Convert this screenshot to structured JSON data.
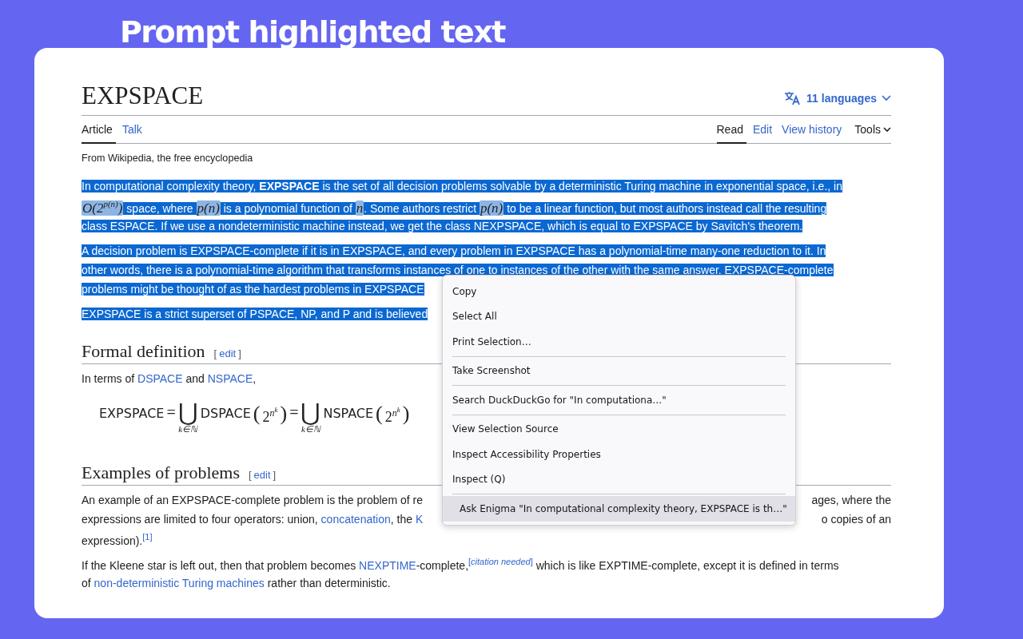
{
  "banner": {
    "title": "Prompt highlighted text"
  },
  "page": {
    "title": "EXPSPACE",
    "languages": "11 languages",
    "tabs_left": [
      {
        "label": "Article",
        "selected": true
      },
      {
        "label": "Talk",
        "selected": false
      }
    ],
    "tabs_right": [
      {
        "label": "Read",
        "selected": true
      },
      {
        "label": "Edit",
        "selected": false
      },
      {
        "label": "View history",
        "selected": false
      }
    ],
    "tools": "Tools",
    "tagline": "From Wikipedia, the free encyclopedia",
    "lead": [
      {
        "selected": true,
        "lines": [
          {
            "left": [
              {
                "kind": "text",
                "text": "In computational complexity theory, **EXPSPACE** is the set of all decision problems solvable by a deterministic Turing machine in exponential space, i.e., in"
              }
            ]
          },
          {
            "left": [
              {
                "kind": "math",
                "text": "O(2$^{p(n)}$)"
              },
              {
                "kind": "text",
                "text": " space, where "
              },
              {
                "kind": "math",
                "text": "p(n)"
              },
              {
                "kind": "text",
                "text": " is a polynomial function of "
              },
              {
                "kind": "math",
                "text": "n"
              },
              {
                "kind": "text",
                "text": ". Some authors restrict "
              },
              {
                "kind": "math",
                "text": "p(n)"
              },
              {
                "kind": "text",
                "text": " to be a linear function, but most authors instead call the resulting"
              }
            ]
          },
          {
            "left": [
              {
                "kind": "text",
                "text": "class ESPACE. If we use a nondeterministic machine instead, we get the class NEXPSPACE, which is equal to EXPSPACE by Savitch's theorem."
              }
            ]
          }
        ]
      },
      {
        "selected": true,
        "lines": [
          {
            "left": [
              {
                "kind": "text",
                "text": "A decision problem is EXPSPACE-complete if it is in EXPSPACE, and every problem in EXPSPACE has a polynomial-time many-one reduction to it. In"
              }
            ]
          },
          {
            "left": [
              {
                "kind": "text",
                "text": "other words, there is a polynomial-time algorithm that transforms instances of one to instances of the other with the same answer. EXPSPACE-complete"
              }
            ]
          },
          {
            "left": [
              {
                "kind": "text",
                "text": "problems might be thought of as the hardest problems in EXPSPACE"
              }
            ]
          }
        ]
      },
      {
        "selected": true,
        "lines": [
          {
            "left": [
              {
                "kind": "text",
                "text": "EXPSPACE is a strict superset of PSPACE, NP, and P and is believed"
              }
            ]
          }
        ]
      }
    ],
    "sections": [
      {
        "heading": "Formal definition",
        "edit_open": "[",
        "edit": "edit",
        "edit_close": "]",
        "blocks": [
          {
            "kind": "paragraph",
            "selected": false,
            "lines": [
              {
                "left": [
                  {
                    "kind": "text",
                    "text": "In terms of "
                  },
                  {
                    "kind": "link",
                    "text": "DSPACE"
                  },
                  {
                    "kind": "text",
                    "text": " and "
                  },
                  {
                    "kind": "link",
                    "text": "NSPACE"
                  },
                  {
                    "kind": "text",
                    "text": ","
                  }
                ]
              }
            ]
          },
          {
            "kind": "formula",
            "lhs": "EXPSPACE",
            "terms": [
              {
                "eq": "=",
                "union": "⋃",
                "index": "k∈ℕ",
                "name": "DSPACE",
                "open": "(",
                "base": "2",
                "exp": "n",
                "exp2": "k",
                "close": ")"
              },
              {
                "eq": "=",
                "union": "⋃",
                "index": "k∈ℕ",
                "name": "NSPACE",
                "open": "(",
                "base": "2",
                "exp": "n",
                "exp2": "k",
                "close": ")"
              }
            ]
          }
        ]
      },
      {
        "heading": "Examples of problems",
        "edit_open": "[",
        "edit": "edit",
        "edit_close": "]",
        "blocks": [
          {
            "kind": "paragraph",
            "selected": false,
            "lines": [
              {
                "left": [
                  {
                    "kind": "text",
                    "text": "An example of an EXPSPACE-complete problem is the problem of re"
                  }
                ],
                "right": [
                  {
                    "kind": "text",
                    "text": "ages, where the"
                  }
                ]
              },
              {
                "left": [
                  {
                    "kind": "text",
                    "text": "expressions are limited to four operators: union, "
                  },
                  {
                    "kind": "link",
                    "text": "concatenation"
                  },
                  {
                    "kind": "text",
                    "text": ", the "
                  },
                  {
                    "kind": "link",
                    "text": "K"
                  }
                ],
                "right": [
                  {
                    "kind": "text",
                    "text": "o copies of an"
                  }
                ]
              },
              {
                "left": [
                  {
                    "kind": "text",
                    "text": "expression)."
                  },
                  {
                    "kind": "sup",
                    "text": "[1]"
                  }
                ]
              }
            ]
          },
          {
            "kind": "paragraph",
            "selected": false,
            "lines": [
              {
                "left": [
                  {
                    "kind": "text",
                    "text": "If the Kleene star is left out, then that problem becomes "
                  },
                  {
                    "kind": "link",
                    "text": "NEXPTIME"
                  },
                  {
                    "kind": "text",
                    "text": "-complete,"
                  },
                  {
                    "kind": "sup",
                    "text": "[*citation needed*]"
                  },
                  {
                    "kind": "text",
                    "text": " which is like EXPTIME-complete, except it is defined in terms"
                  }
                ]
              },
              {
                "left": [
                  {
                    "kind": "text",
                    "text": "of "
                  },
                  {
                    "kind": "link",
                    "text": "non-deterministic Turing machines"
                  },
                  {
                    "kind": "text",
                    "text": " rather than deterministic."
                  }
                ]
              }
            ]
          }
        ]
      }
    ]
  },
  "context_menu": {
    "items": [
      {
        "kind": "item",
        "label": "Copy",
        "selected": false
      },
      {
        "kind": "item",
        "label": "Select All",
        "selected": false
      },
      {
        "kind": "item",
        "label": "Print Selection…",
        "selected": false
      },
      {
        "kind": "separator"
      },
      {
        "kind": "item",
        "label": "Take Screenshot",
        "selected": false
      },
      {
        "kind": "separator"
      },
      {
        "kind": "item",
        "label": "Search DuckDuckGo for \"In computationa…\"",
        "selected": false
      },
      {
        "kind": "separator"
      },
      {
        "kind": "item",
        "label": "View Selection Source",
        "selected": false
      },
      {
        "kind": "item",
        "label": "Inspect Accessibility Properties",
        "selected": false
      },
      {
        "kind": "item",
        "label": "Inspect (Q)",
        "selected": false
      },
      {
        "kind": "separator"
      },
      {
        "kind": "extension",
        "label": "Ask Enigma \"In computational complexity theory, EXPSPACE is th…\"",
        "selected": true
      }
    ]
  }
}
